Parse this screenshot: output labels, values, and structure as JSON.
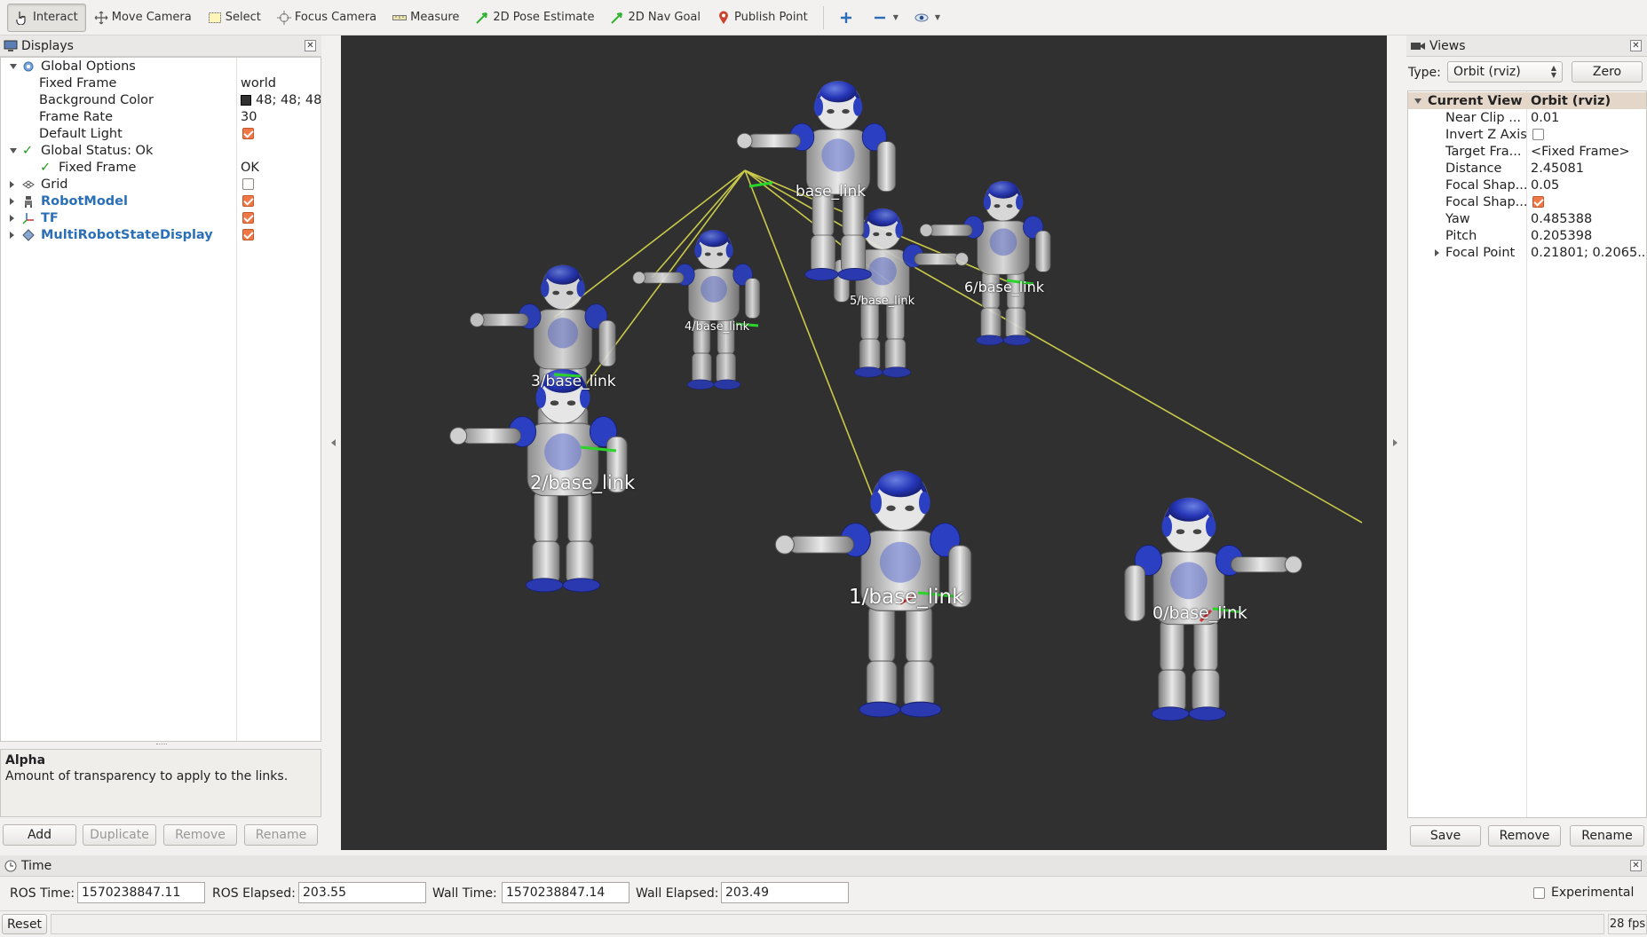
{
  "toolbar": {
    "tools": [
      {
        "label": "Interact",
        "icon": "hand-pointer-icon",
        "active": true
      },
      {
        "label": "Move Camera",
        "icon": "move-camera-icon",
        "active": false
      },
      {
        "label": "Select",
        "icon": "select-rectangle-icon",
        "active": false
      },
      {
        "label": "Focus Camera",
        "icon": "focus-crosshair-icon",
        "active": false
      },
      {
        "label": "Measure",
        "icon": "ruler-icon",
        "active": false
      },
      {
        "label": "2D Pose Estimate",
        "icon": "green-arrow-icon",
        "active": false
      },
      {
        "label": "2D Nav Goal",
        "icon": "green-arrow-icon",
        "active": false
      },
      {
        "label": "Publish Point",
        "icon": "map-pin-icon",
        "active": false
      }
    ]
  },
  "displays": {
    "title": "Displays",
    "rows": [
      {
        "label": "Global Options",
        "value": ""
      },
      {
        "label": "Fixed Frame",
        "value": "world"
      },
      {
        "label": "Background Color",
        "value": "48; 48; 48"
      },
      {
        "label": "Frame Rate",
        "value": "30"
      },
      {
        "label": "Default Light",
        "value": ""
      },
      {
        "label": "Global Status: Ok",
        "value": ""
      },
      {
        "label": "Fixed Frame",
        "value": "OK"
      },
      {
        "label": "Grid",
        "value": ""
      },
      {
        "label": "RobotModel",
        "value": ""
      },
      {
        "label": "TF",
        "value": ""
      },
      {
        "label": "MultiRobotStateDisplay",
        "value": ""
      }
    ],
    "checks": {
      "default_light": true,
      "grid": false,
      "robot_model": true,
      "tf": true,
      "multi_robot": true
    },
    "background_swatch": "#303030",
    "desc_title": "Alpha",
    "desc_text": "Amount of transparency to apply to the links.",
    "buttons": {
      "add": "Add",
      "duplicate": "Duplicate",
      "remove": "Remove",
      "rename": "Rename"
    }
  },
  "viewport": {
    "background": "#303030",
    "frame_labels": [
      "base_link",
      "6/base_link",
      "5/base_link",
      "4/base_link",
      "3/base_link",
      "2/base_link",
      "1/base_link",
      "0/base_link"
    ]
  },
  "views": {
    "title": "Views",
    "type_label": "Type:",
    "type_value": "Orbit (rviz)",
    "zero_button": "Zero",
    "header": {
      "name": "Current View",
      "value": "Orbit (rviz)"
    },
    "rows": [
      {
        "label": "Near Clip ...",
        "value": "0.01"
      },
      {
        "label": "Invert Z Axis",
        "value": ""
      },
      {
        "label": "Target Fra...",
        "value": "<Fixed Frame>"
      },
      {
        "label": "Distance",
        "value": "2.45081"
      },
      {
        "label": "Focal Shap...",
        "value": "0.05"
      },
      {
        "label": "Focal Shap...",
        "value": ""
      },
      {
        "label": "Yaw",
        "value": "0.485388"
      },
      {
        "label": "Pitch",
        "value": "0.205398"
      },
      {
        "label": "Focal Point",
        "value": "0.21801; 0.2065..."
      }
    ],
    "checks": {
      "invert_z": false,
      "focal_shape_fixed": true
    },
    "buttons": {
      "save": "Save",
      "remove": "Remove",
      "rename": "Rename"
    }
  },
  "time": {
    "title": "Time",
    "ros_time_label": "ROS Time:",
    "ros_time": "1570238847.11",
    "ros_elapsed_label": "ROS Elapsed:",
    "ros_elapsed": "203.55",
    "wall_time_label": "Wall Time:",
    "wall_time": "1570238847.14",
    "wall_elapsed_label": "Wall Elapsed:",
    "wall_elapsed": "203.49",
    "experimental_label": "Experimental",
    "experimental": false
  },
  "status": {
    "reset": "Reset",
    "fps": "28 fps"
  }
}
